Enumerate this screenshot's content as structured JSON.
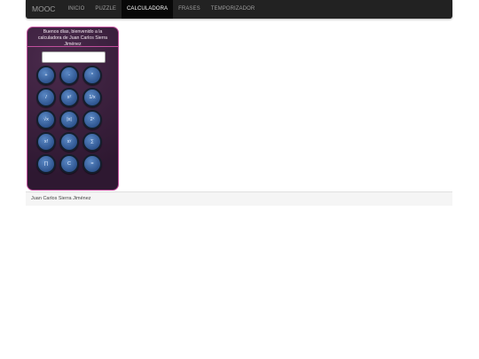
{
  "navbar": {
    "brand": "MOOC",
    "items": [
      {
        "label": "INICIO",
        "active": false
      },
      {
        "label": "PUZZLE",
        "active": false
      },
      {
        "label": "CALCULADORA",
        "active": true
      },
      {
        "label": "FRASES",
        "active": false
      },
      {
        "label": "TEMPORIZADOR",
        "active": false
      }
    ]
  },
  "calculator": {
    "greeting": "Buenos días, bienvenido a la calculadora de Juan Carlos Sierra Jiménez",
    "display_value": "",
    "keys": [
      "+",
      "-",
      "*",
      "/",
      "x²",
      "1/x",
      "√x",
      "|x|",
      "2ˣ",
      "x!",
      "xʸ",
      "∑",
      "∏",
      "C",
      "="
    ]
  },
  "footer": {
    "text": "Juan Carlos Sierra Jiménez"
  },
  "colors": {
    "navbar_bg": "#222222",
    "calc_bg": "#3a1e3c",
    "calc_border": "#c04f9c",
    "key_blue": "#2f5590"
  }
}
